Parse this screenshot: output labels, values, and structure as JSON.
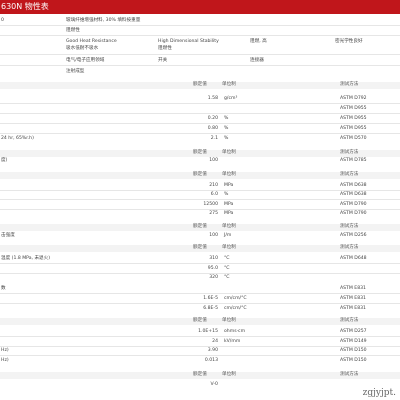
{
  "title": "630N 物性表",
  "top": {
    "r1": "0",
    "desc": "玻璃纤维增强材料, 30% 填料按重量",
    "flame": "阻燃性",
    "feat1": "Good Heat Resistance",
    "feat2": "High Dimensional Stability",
    "feat3": "阻燃, 高",
    "feat4": "密光学性良好",
    "feat5": "吸水低耐不吸水",
    "feat6": "阻燃性",
    "app1": "电气/电子应用领域",
    "app2": "开关",
    "app3": "连接器",
    "process": "注射成型"
  },
  "headers": {
    "nominal": "额定值",
    "unit": "单位制",
    "method": "测试方法"
  },
  "physical": [
    {
      "label": "",
      "value": "1.58",
      "unit": "g/cm³",
      "method": "ASTM D792"
    },
    {
      "label": "",
      "value": "",
      "unit": "",
      "method": "ASTM D955"
    },
    {
      "label": "",
      "value": "0.20",
      "unit": "%",
      "method": "ASTM D955"
    },
    {
      "label": "",
      "value": "0.80",
      "unit": "%",
      "method": "ASTM D955"
    },
    {
      "label": "24 hr, 65%r.h)",
      "value": "2.1",
      "unit": "%",
      "method": "ASTM D570"
    }
  ],
  "hardness": {
    "label": "度)",
    "value": "100",
    "unit": "",
    "method": "ASTM D785"
  },
  "mechanical": [
    {
      "value": "210",
      "unit": "MPa",
      "method": "ASTM D638"
    },
    {
      "value": "6.0",
      "unit": "%",
      "method": "ASTM D638"
    },
    {
      "value": "12500",
      "unit": "MPa",
      "method": "ASTM D790"
    },
    {
      "value": "275",
      "unit": "MPa",
      "method": "ASTM D790"
    }
  ],
  "impact": {
    "label": "击强度",
    "value": "100",
    "unit": "J/m",
    "method": "ASTM D256"
  },
  "thermal": [
    {
      "label": "温度 (1.8 MPa, 未退火)",
      "value": "310",
      "unit": "°C",
      "method": "ASTM D648"
    },
    {
      "label": "",
      "value": "95.0",
      "unit": "°C",
      "method": ""
    },
    {
      "label": "",
      "value": "320",
      "unit": "°C",
      "method": ""
    }
  ],
  "cte": [
    {
      "label": "数",
      "value": "",
      "unit": "",
      "method": "ASTM E831"
    },
    {
      "label": "",
      "value": "1.6E-5",
      "unit": "cm/cm/°C",
      "method": "ASTM E831"
    },
    {
      "label": "",
      "value": "6.8E-5",
      "unit": "cm/cm/°C",
      "method": "ASTM E831"
    }
  ],
  "electrical": [
    {
      "label": "",
      "value": "1.0E+15",
      "unit": "ohms·cm",
      "method": "ASTM D257"
    },
    {
      "label": "",
      "value": "24",
      "unit": "kV/mm",
      "method": "ASTM D149"
    },
    {
      "label": "Hz)",
      "value": "3.90",
      "unit": "",
      "method": "ASTM D150"
    },
    {
      "label": "Hz)",
      "value": "0.013",
      "unit": "",
      "method": "ASTM D150"
    }
  ],
  "flammability": {
    "value": "V-0",
    "unit": "",
    "method": ""
  },
  "watermark": "zgjyjpt."
}
